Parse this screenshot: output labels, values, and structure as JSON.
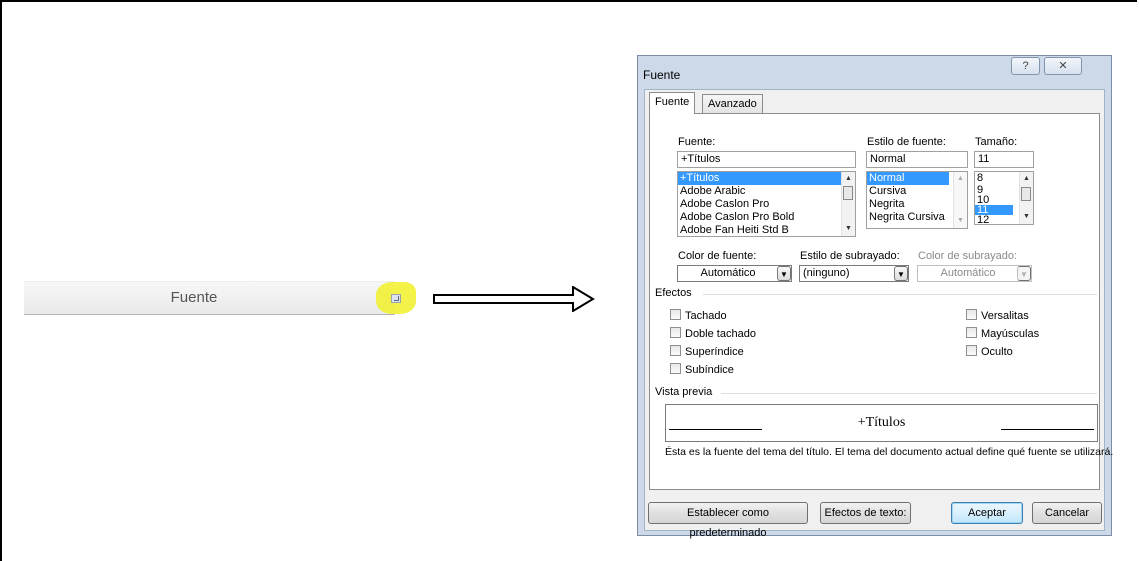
{
  "ribbon": {
    "group_label": "Fuente"
  },
  "dialog": {
    "title": "Fuente",
    "help_glyph": "?",
    "close_glyph": "✕",
    "tabs": [
      {
        "label": "Fuente",
        "active": true
      },
      {
        "label": "Avanzado",
        "active": false
      }
    ],
    "font": {
      "label": "Fuente:",
      "value": "+Títulos",
      "list": [
        "+Títulos",
        "Adobe Arabic",
        "Adobe Caslon Pro",
        "Adobe Caslon Pro Bold",
        "Adobe Fan Heiti Std B"
      ],
      "selected": "+Títulos"
    },
    "style": {
      "label": "Estilo de fuente:",
      "value": "Normal",
      "list": [
        "Normal",
        "Cursiva",
        "Negrita",
        "Negrita Cursiva"
      ],
      "selected": "Normal"
    },
    "size": {
      "label": "Tamaño:",
      "value": "11",
      "list": [
        "8",
        "9",
        "10",
        "11",
        "12"
      ],
      "selected": "11"
    },
    "font_color": {
      "label": "Color de fuente:",
      "value": "Automático"
    },
    "underline_style": {
      "label": "Estilo de subrayado:",
      "value": "(ninguno)"
    },
    "underline_color": {
      "label": "Color de subrayado:",
      "value": "Automático"
    },
    "effects": {
      "label": "Efectos",
      "left": [
        "Tachado",
        "Doble tachado",
        "Superíndice",
        "Subíndice"
      ],
      "right": [
        "Versalitas",
        "Mayúsculas",
        "Oculto"
      ]
    },
    "preview": {
      "label": "Vista previa",
      "sample": "+Títulos",
      "description": "Ésta es la fuente del tema del título. El tema del documento actual define qué fuente se utilizará."
    },
    "buttons": {
      "set_default": "Establecer como predeterminado",
      "text_effects": "Efectos de texto:",
      "ok": "Aceptar",
      "cancel": "Cancelar"
    }
  },
  "colors": {
    "selection": "#3399ff",
    "highlight": "#f0f028",
    "dialog_frame": "#cdd9e8"
  }
}
